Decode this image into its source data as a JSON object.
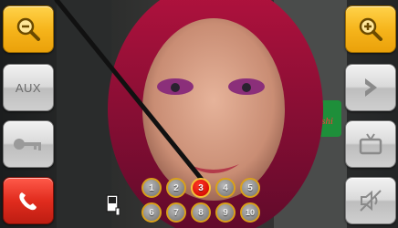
{
  "left_rail": {
    "zoom_out": {
      "icon": "zoom-out-icon"
    },
    "aux": {
      "label": "AUX"
    },
    "key": {
      "icon": "key-icon"
    },
    "hangup": {
      "icon": "phone-hangup-icon"
    }
  },
  "right_rail": {
    "zoom_in": {
      "icon": "zoom-in-icon"
    },
    "next": {
      "icon": "chevron-right-icon"
    },
    "tv": {
      "icon": "tv-icon"
    },
    "mute": {
      "icon": "speaker-mute-icon"
    }
  },
  "keypad": {
    "keys": [
      "1",
      "2",
      "3",
      "4",
      "5",
      "6",
      "7",
      "8",
      "9",
      "10"
    ],
    "active_key": "3"
  },
  "colors": {
    "zoom_button": "#f6b51c",
    "hangup_button": "#e12c1e",
    "active_key": "#d90f05",
    "key_ring": "#d9a01a"
  }
}
